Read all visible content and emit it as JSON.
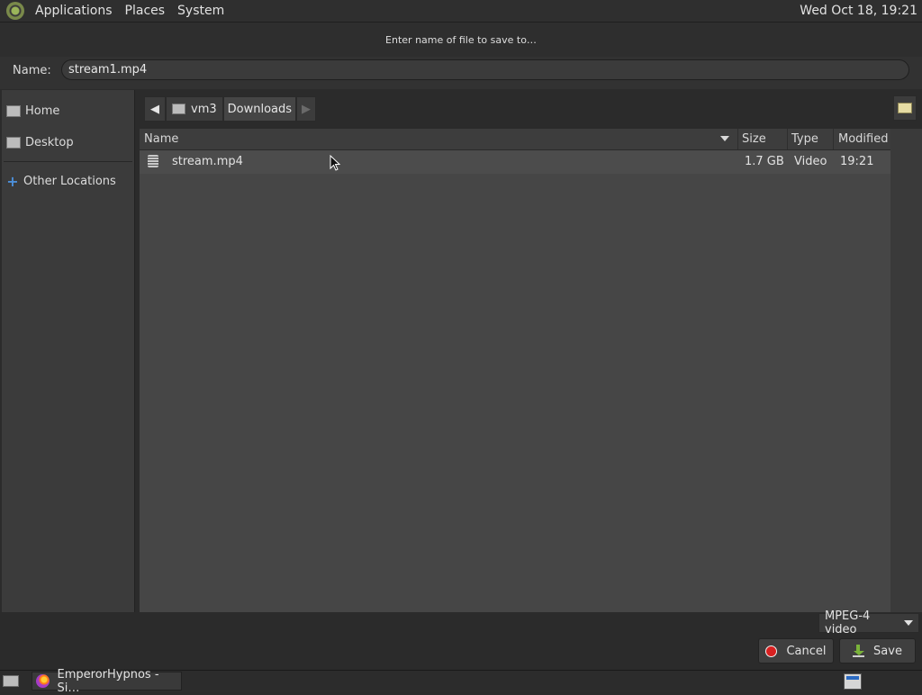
{
  "topbar": {
    "menus": [
      "Applications",
      "Places",
      "System"
    ],
    "clock": "Wed Oct 18, 19:21"
  },
  "dialog": {
    "title": "Enter name of file to save to…",
    "name_label": "Name:",
    "name_value": "stream1.mp4"
  },
  "sidebar": {
    "items": [
      {
        "label": "Home",
        "icon": "home-folder-icon"
      },
      {
        "label": "Desktop",
        "icon": "desktop-folder-icon"
      },
      {
        "label": "Other Locations",
        "icon": "plus-icon"
      }
    ]
  },
  "pathbar": {
    "segments": [
      "vm3",
      "Downloads"
    ]
  },
  "file_list": {
    "columns": [
      "Name",
      "Size",
      "Type",
      "Modified"
    ],
    "rows": [
      {
        "name": "stream.mp4",
        "size": "1.7 GB",
        "type": "Video",
        "modified": "19:21"
      }
    ]
  },
  "filter": {
    "selected": "MPEG-4 video"
  },
  "buttons": {
    "cancel": "Cancel",
    "save": "Save"
  },
  "taskbar": {
    "task_label": "EmperorHypnos - Si…"
  },
  "colors": {
    "accent_blue": "#4c8fd9",
    "cancel_red": "#d82020",
    "save_green": "#7ab33a"
  }
}
